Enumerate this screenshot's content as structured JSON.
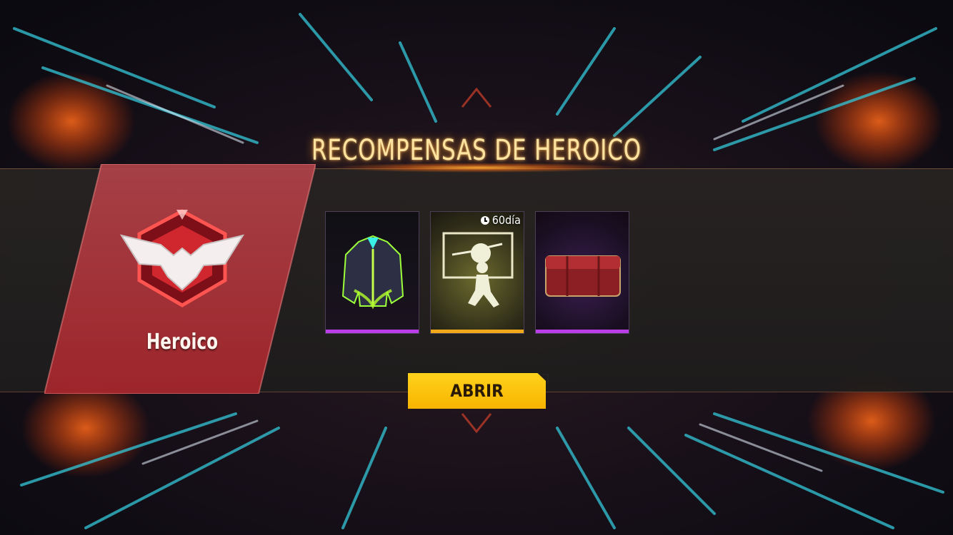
{
  "screen": {
    "title": "RECOMPENSAS DE HEROICO"
  },
  "rank": {
    "name": "Heroico",
    "badge_icon": "eagle-rank-emblem-icon",
    "accent": "#c4373b"
  },
  "rewards": [
    {
      "item": "jacket-icon",
      "rarity_color": "#b93ee8"
    },
    {
      "item": "emote-poster-icon",
      "rarity_color": "#f2a81b",
      "timer": "60día",
      "timer_icon": "clock-icon"
    },
    {
      "item": "crate-icon",
      "rarity_color": "#b93ee8"
    }
  ],
  "open_button": {
    "label": "ABRIR",
    "color": "#ffc400"
  }
}
